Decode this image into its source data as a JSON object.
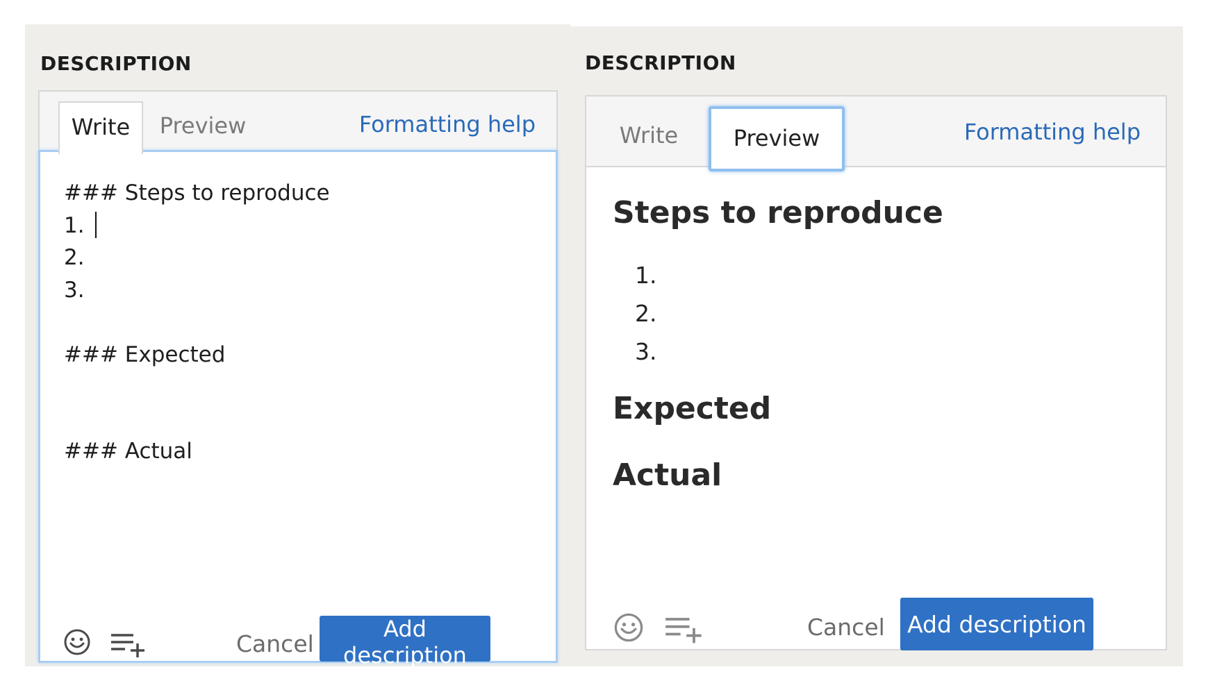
{
  "left": {
    "section_title": "DESCRIPTION",
    "tabs": [
      "Write",
      "Preview"
    ],
    "active_tab": "Write",
    "formatting_help": "Formatting help",
    "text_lines": [
      "### Steps to reproduce",
      "1. ",
      "2.",
      "3.",
      "",
      "### Expected",
      "",
      "",
      "### Actual"
    ],
    "cancel_label": "Cancel",
    "add_label": "Add description"
  },
  "right": {
    "section_title": "DESCRIPTION",
    "tabs": [
      "Write",
      "Preview"
    ],
    "active_tab": "Preview",
    "formatting_help": "Formatting help",
    "preview": {
      "heading1": "Steps to reproduce",
      "list": [
        "1.",
        "2.",
        "3."
      ],
      "heading2": "Expected",
      "heading3": "Actual"
    },
    "cancel_label": "Cancel",
    "add_label": "Add description"
  },
  "icons": {
    "emoji": "smiley-face-icon",
    "add_list": "add-list-icon"
  },
  "colors": {
    "link": "#2a6ab8",
    "primary_button": "#2f71c4",
    "focus_border": "#a9cdf3",
    "panel_bg": "#efeeeb"
  }
}
